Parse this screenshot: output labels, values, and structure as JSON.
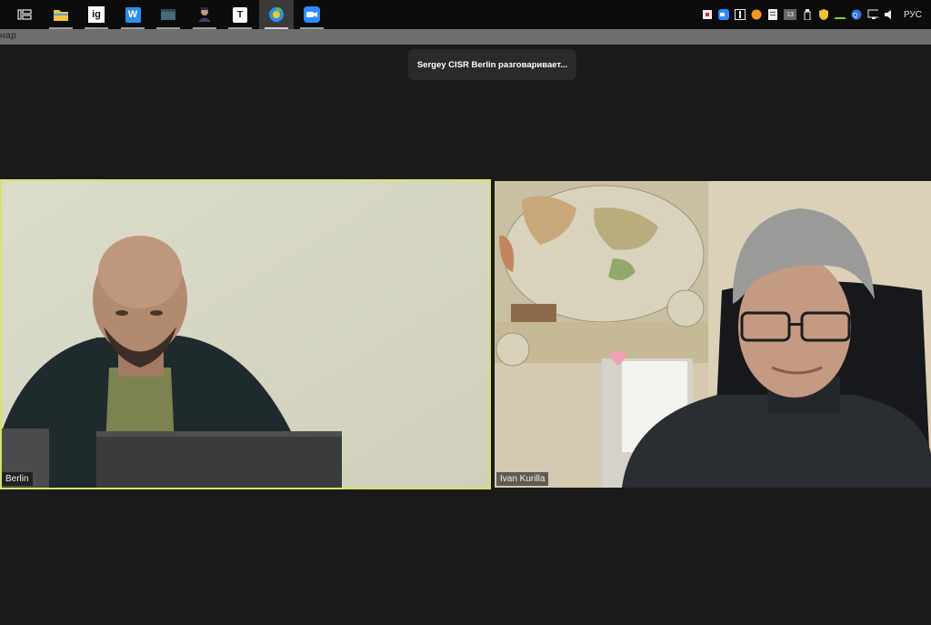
{
  "taskbar": {
    "icons": [
      {
        "name": "task-view-icon",
        "active": false
      },
      {
        "name": "file-explorer-icon",
        "active": false
      },
      {
        "name": "ig-app-icon",
        "label": "ig",
        "active": false
      },
      {
        "name": "wps-writer-icon",
        "label": "W",
        "active": false
      },
      {
        "name": "app-window-icon",
        "active": false
      },
      {
        "name": "user-app-icon",
        "active": false
      },
      {
        "name": "typora-icon",
        "label": "T",
        "active": false
      },
      {
        "name": "browser-icon",
        "active": true
      },
      {
        "name": "zoom-icon",
        "active": false
      }
    ],
    "tray": {
      "language": "РУС",
      "badge_number": "13"
    }
  },
  "titlebar": {
    "text": "нар"
  },
  "toast": {
    "text": "Sergey CISR Berlin разговаривает..."
  },
  "participants": [
    {
      "name": "Berlin",
      "speaking": true
    },
    {
      "name": "Ivan Kurilla",
      "speaking": false
    }
  ],
  "colors": {
    "speaker_border": "#d6e36a",
    "background": "#1a1a1a",
    "titlebar": "#6e6e6e"
  }
}
